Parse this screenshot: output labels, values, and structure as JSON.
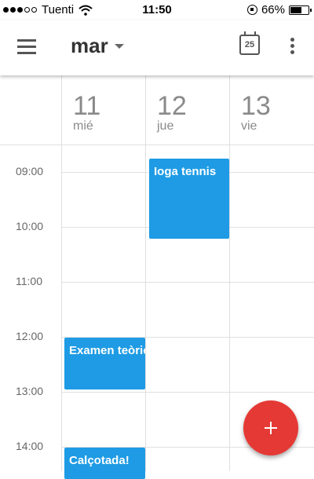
{
  "status_bar": {
    "carrier": "Tuenti",
    "time": "11:50",
    "battery_percent": "66%",
    "battery_level": 0.66,
    "signal_bars_filled": 3,
    "signal_bars_total": 5
  },
  "app_bar": {
    "month": "mar",
    "today_day": "25",
    "icons": [
      "menu-icon",
      "dropdown-caret-icon",
      "calendar-today-icon",
      "more-vert-icon"
    ]
  },
  "days": [
    {
      "number": "11",
      "name": "mié"
    },
    {
      "number": "12",
      "name": "jue"
    },
    {
      "number": "13",
      "name": "vie"
    }
  ],
  "hours": [
    "09:00",
    "10:00",
    "11:00",
    "12:00",
    "13:00",
    "14:00"
  ],
  "events": [
    {
      "title": "Ioga tennis",
      "day": 1,
      "start": "09:00",
      "end": "10:30"
    },
    {
      "title": "Examen teòric",
      "day": 0,
      "start": "12:00",
      "end": "13:00"
    },
    {
      "title": "Calçotada!",
      "day": 0,
      "start": "14:00",
      "end": "15:00"
    }
  ],
  "colors": {
    "event": "#1e9be4",
    "fab": "#e53935",
    "grid": "#e0e0e0",
    "text_muted": "#8a8a8a"
  },
  "fab": {
    "icon": "plus-icon"
  }
}
